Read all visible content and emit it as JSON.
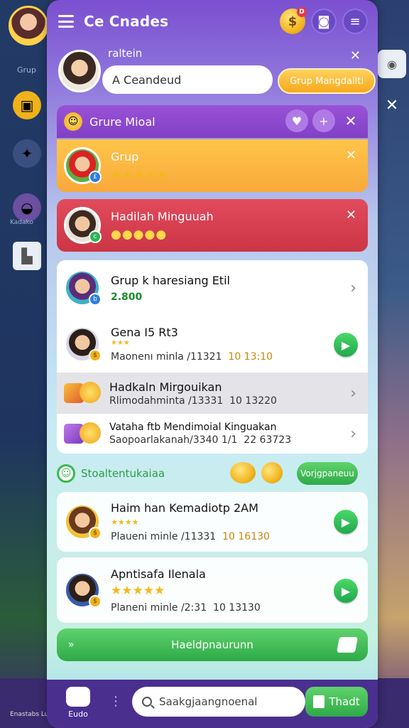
{
  "header": {
    "title": "Ce Cnades"
  },
  "background": {
    "left_labels": [
      "Grup",
      "Kadako"
    ],
    "bottom_left_label": "Enastabs Lurna"
  },
  "profile": {
    "name": "raltein",
    "input_value": "A Ceandeud",
    "action_label": "Grup Mangdaliti"
  },
  "group_panel": {
    "title": "Grure Mioal"
  },
  "cards": [
    {
      "title": "Grup",
      "subtitle": "★★★★★"
    },
    {
      "title": "Hadilah Minguuah",
      "subtitle": "●●●●●"
    }
  ],
  "list": [
    {
      "title": "Grup k haresiang Etil",
      "subtitle": "2.800"
    },
    {
      "title": "Gena I5 Rt3",
      "stars": "★★★",
      "meta": "Maonenı minla /11321",
      "meta2": "10 13:10"
    },
    {
      "title": "Hadkaln Mirgouikan",
      "meta": "Rlimodahminta /13331",
      "meta2": "10 13220"
    },
    {
      "title": "Vataha ftb Mendimoial Kinguakan",
      "meta": "Saopoarlakanah/3340 1/1",
      "meta2": "22 63723"
    }
  ],
  "section": {
    "title": "Stoaltentukaiaa",
    "button_label": "Vorjgpaneuu"
  },
  "list2": [
    {
      "title": "Haim han Kemadiotp 2AM",
      "stars": "★★★★",
      "meta": "Plaueni minle /11331",
      "meta2": "10 16130"
    },
    {
      "title": "Apntisafa Ilenala",
      "stars": "★★★★★",
      "meta": "Planeni minle /2:31",
      "meta2": "10 13130"
    }
  ],
  "cta": {
    "label": "Haeldpnaurunn"
  },
  "bottom_nav": {
    "home_label": "Eudo",
    "search_placeholder": "Saakgjaangnoenal",
    "button_label": "Thadt"
  },
  "colors": {
    "accent_purple": "#7b4fd0",
    "orange": "#ffc54a",
    "red": "#e14b5c",
    "green": "#2eaa48"
  }
}
